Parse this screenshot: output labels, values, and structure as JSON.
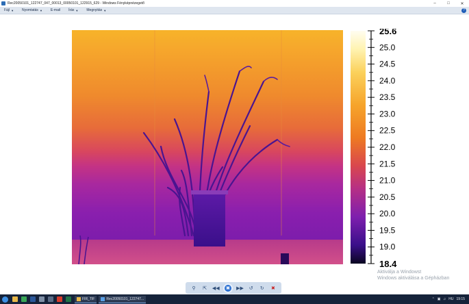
{
  "window": {
    "title": "Rec20050101_122747_047_00013_00050101_122915_629 - Windows Fényképnézegető",
    "minimize_icon": "minimize-icon",
    "maximize_icon": "maximize-icon",
    "close_icon": "close-icon"
  },
  "menu": {
    "items": [
      {
        "label": "Fájl"
      },
      {
        "label": "Nyomtatás"
      },
      {
        "label": "E-mail"
      },
      {
        "label": "Írás"
      },
      {
        "label": "Megnyitás"
      }
    ],
    "help_label": "?"
  },
  "image": {
    "scale": {
      "max_label": "25.6",
      "min_label": "18.4",
      "ticks": [
        "25.0",
        "24.5",
        "24.0",
        "23.5",
        "23.0",
        "22.5",
        "22.0",
        "21.5",
        "21.0",
        "20.5",
        "20.0",
        "19.5",
        "19.0"
      ]
    }
  },
  "watermark": {
    "line1": "Aktiválja a Windowst",
    "line2": "Windows aktiválása a Gépházban"
  },
  "controls": {
    "zoom_icon": "magnifier-icon",
    "actual_size_icon": "actual-size-icon",
    "previous_icon": "previous-icon",
    "slideshow_icon": "slideshow-icon",
    "next_icon": "next-icon",
    "rotate_left_icon": "rotate-left-icon",
    "rotate_right_icon": "rotate-right-icon",
    "delete_icon": "delete-icon"
  },
  "taskbar": {
    "tasks": [
      {
        "label": "FIR_TIF"
      },
      {
        "label": "Rec20050101_122747..."
      }
    ],
    "tray": {
      "lang": "HU",
      "time": "19:15"
    }
  }
}
